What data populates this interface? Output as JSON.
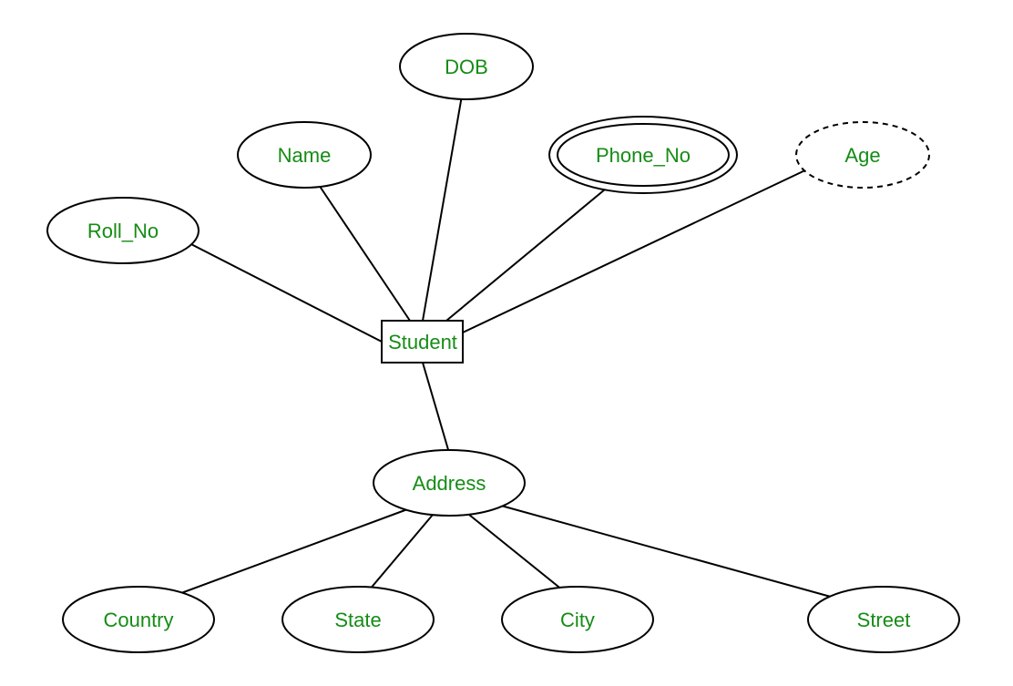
{
  "diagram": {
    "type": "er-diagram",
    "entity": {
      "label": "Student"
    },
    "attributes": {
      "dob": {
        "label": "DOB",
        "kind": "simple"
      },
      "name": {
        "label": "Name",
        "kind": "simple"
      },
      "phone_no": {
        "label": "Phone_No",
        "kind": "multivalued"
      },
      "age": {
        "label": "Age",
        "kind": "derived"
      },
      "roll_no": {
        "label": "Roll_No",
        "kind": "simple"
      },
      "address": {
        "label": "Address",
        "kind": "composite",
        "components": {
          "country": {
            "label": "Country"
          },
          "state": {
            "label": "State"
          },
          "city": {
            "label": "City"
          },
          "street": {
            "label": "Street"
          }
        }
      }
    }
  }
}
